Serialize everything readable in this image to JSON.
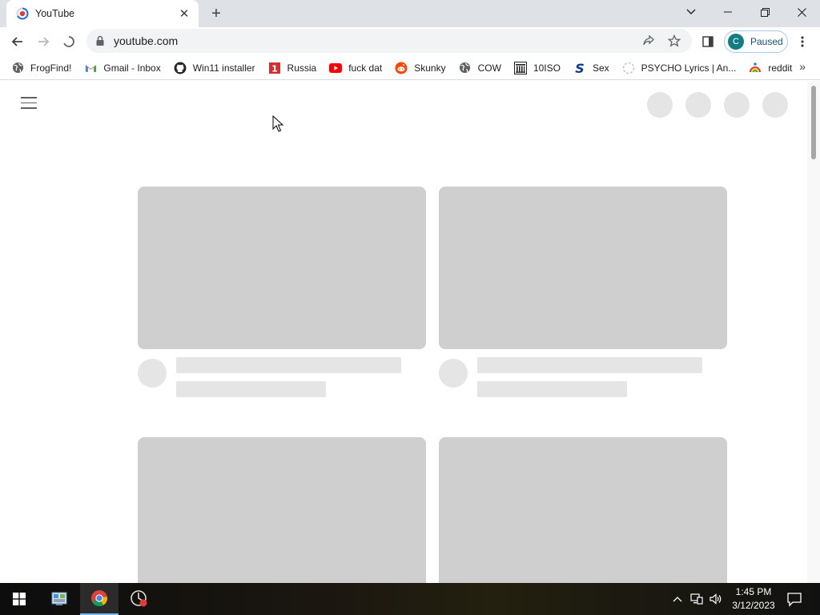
{
  "browser": {
    "tab": {
      "title": "YouTube"
    },
    "window_controls": [
      "minimize",
      "restore",
      "close"
    ],
    "url": "youtube.com",
    "profile": {
      "initial": "C",
      "status": "Paused"
    },
    "bookmarks": [
      {
        "label": "FrogFind!",
        "icon": "globe-icon"
      },
      {
        "label": "Gmail - Inbox",
        "icon": "gmail-icon"
      },
      {
        "label": "Win11 installer",
        "icon": "github-icon"
      },
      {
        "label": "Russia",
        "icon": "russia-icon"
      },
      {
        "label": "fuck dat",
        "icon": "youtube-icon"
      },
      {
        "label": "Skunky",
        "icon": "reddit-icon"
      },
      {
        "label": "COW",
        "icon": "globe-icon"
      },
      {
        "label": "10ISO",
        "icon": "building-icon"
      },
      {
        "label": "Sex",
        "icon": "s-logo-icon"
      },
      {
        "label": "PSYCHO Lyrics | An...",
        "icon": "loading-icon"
      },
      {
        "label": "reddit",
        "icon": "rainbow-icon"
      }
    ]
  },
  "taskbar": {
    "time": "1:45 PM",
    "date": "3/12/2023"
  },
  "colors": {
    "tabstrip": "#dee1e6",
    "skeleton_thumb": "#cfcfcf",
    "skeleton_line": "#e5e5e5",
    "profile_avatar": "#127d82"
  }
}
